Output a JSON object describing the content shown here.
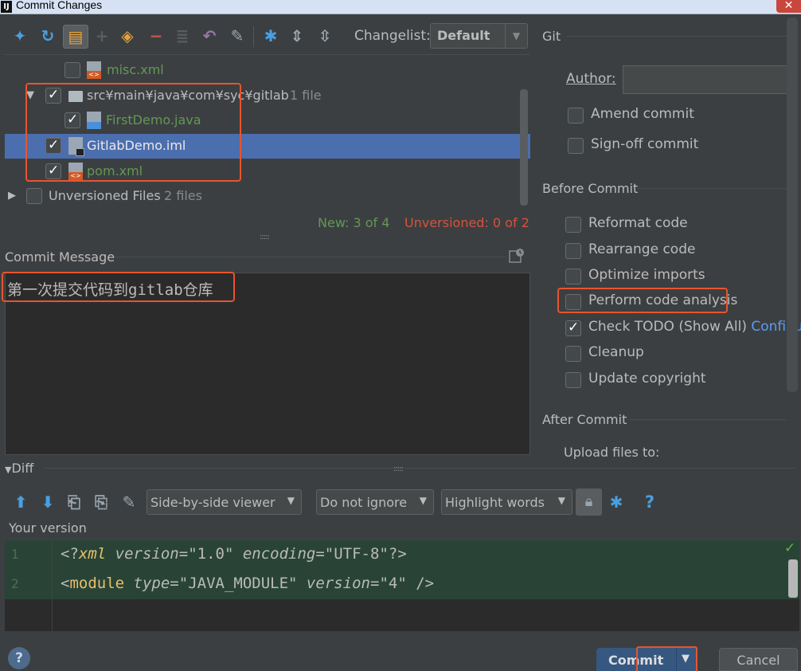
{
  "window": {
    "title": "Commit Changes",
    "close_glyph": "✕",
    "app_icon_letter": "IJ"
  },
  "toolbar": {
    "icons": [
      "show-diff-icon",
      "refresh-icon",
      "group-by-directory-icon",
      "add-icon",
      "move-to-changelist-icon",
      "remove-icon",
      "group-icon",
      "rollback-icon",
      "edit-source-icon",
      "settings-icon",
      "expand-all-icon",
      "collapse-all-icon"
    ],
    "changelist_label": "Changelist:",
    "changelist_value": "Default"
  },
  "tree": {
    "rows": [
      {
        "name": "misc.xml",
        "checked": false,
        "color": "green"
      },
      {
        "name": "src¥main¥java¥com¥syc¥gitlab",
        "count": "1 file",
        "checked": true,
        "expanded": true
      },
      {
        "name": "FirstDemo.java",
        "checked": true,
        "color": "green"
      },
      {
        "name": "GitlabDemo.iml",
        "checked": true,
        "selected": true
      },
      {
        "name": "pom.xml",
        "checked": true,
        "color": "green"
      },
      {
        "name": "Unversioned Files",
        "count": "2 files",
        "checked": false,
        "expanded": false
      }
    ],
    "new_count": "New: 3 of 4",
    "unversioned_count": "Unversioned: 0 of 2"
  },
  "commit_message": {
    "label": "Commit Message",
    "text": "第一次提交代码到gitlab仓库"
  },
  "git": {
    "section": "Git",
    "author_label": "Author:",
    "author_value": "",
    "amend": "Amend commit",
    "signoff": "Sign-off commit"
  },
  "before_commit": {
    "section": "Before Commit",
    "options": [
      {
        "label": "Reformat code",
        "checked": false
      },
      {
        "label": "Rearrange code",
        "checked": false
      },
      {
        "label": "Optimize imports",
        "checked": false
      },
      {
        "label": "Perform code analysis",
        "checked": false
      },
      {
        "label": "Check TODO (Show All)",
        "checked": true,
        "link": "Configure"
      },
      {
        "label": "Cleanup",
        "checked": false
      },
      {
        "label": "Update copyright",
        "checked": false
      }
    ]
  },
  "after_commit": {
    "section": "After Commit",
    "upload_label": "Upload files to:"
  },
  "diff": {
    "label": "Diff",
    "viewer": "Side-by-side viewer",
    "ignore": "Do not ignore",
    "highlight": "Highlight words",
    "help": "?",
    "your_version": "Your version",
    "lines": [
      {
        "num": "1"
      },
      {
        "num": "2"
      }
    ],
    "line1": {
      "a": "<?",
      "b": "xml",
      "c": " version",
      "d": "=",
      "e": "\"1.0\"",
      "f": " encoding",
      "g": "=",
      "h": "\"UTF-8\"",
      "i": "?>"
    },
    "line2": {
      "a": "<",
      "b": "module",
      "c": " type",
      "d": "=",
      "e": "\"JAVA_MODULE\"",
      "f": " version",
      "g": "=",
      "h": "\"4\"",
      "i": " />"
    }
  },
  "buttons": {
    "help": "?",
    "commit": "Commit",
    "cancel": "Cancel"
  },
  "colors": {
    "annotation": "#e8542f",
    "selection": "#4b6eaf",
    "new_file": "#629755",
    "unversioned": "#d5533c",
    "diff_added": "#294436"
  }
}
